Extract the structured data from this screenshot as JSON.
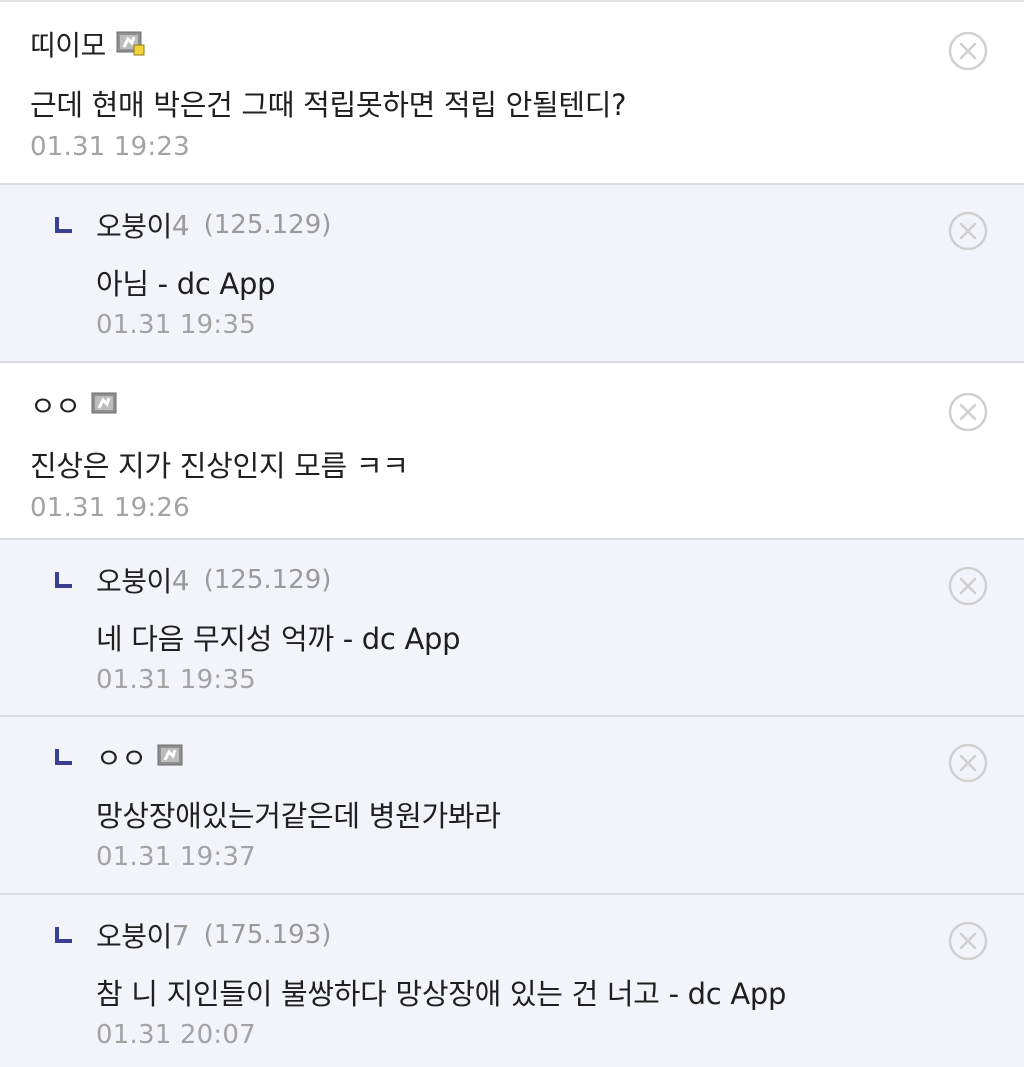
{
  "comments": [
    {
      "type": "top",
      "nickname": "띠이모",
      "nick_suffix": "",
      "ip": "",
      "has_gallog_icon": true,
      "gallog_variant": "fixed-new",
      "text": "근데 현매 박은건 그때 적립못하면 적립 안될텐디?",
      "date": "01.31 19:23"
    },
    {
      "type": "reply",
      "nickname": "오붕이",
      "nick_suffix": "4",
      "ip": "(125.129)",
      "has_gallog_icon": false,
      "text": "아님 - dc App",
      "date": "01.31 19:35"
    },
    {
      "type": "top",
      "nickname": "ㅇㅇ",
      "nick_suffix": "",
      "ip": "",
      "has_gallog_icon": true,
      "gallog_variant": "fixed",
      "text": "진상은 지가 진상인지 모름 ㅋㅋ",
      "date": "01.31 19:26"
    },
    {
      "type": "reply",
      "nickname": "오붕이",
      "nick_suffix": "4",
      "ip": "(125.129)",
      "has_gallog_icon": false,
      "text": "네 다음 무지성 억까 - dc App",
      "date": "01.31 19:35"
    },
    {
      "type": "reply",
      "nickname": "ㅇㅇ",
      "nick_suffix": "",
      "ip": "",
      "has_gallog_icon": true,
      "gallog_variant": "fixed",
      "text": "망상장애있는거같은데 병원가봐라",
      "date": "01.31 19:37"
    },
    {
      "type": "reply",
      "nickname": "오붕이",
      "nick_suffix": "7",
      "ip": "(175.193)",
      "has_gallog_icon": false,
      "text": "참 니 지인들이 불쌍하다 망상장애 있는 건 너고 - dc App",
      "date": "01.31 20:07"
    }
  ],
  "icons": {
    "reply_mark": "reply-arrow-icon",
    "delete": "delete-circle-x-icon",
    "gallog": "gallog-user-icon"
  },
  "colors": {
    "reply_bg": "#f3f4f9",
    "top_bg": "#ffffff",
    "reply_mark": "#3b3f8f",
    "meta_gray": "#9a9a9a",
    "divider": "#dadbe0"
  }
}
